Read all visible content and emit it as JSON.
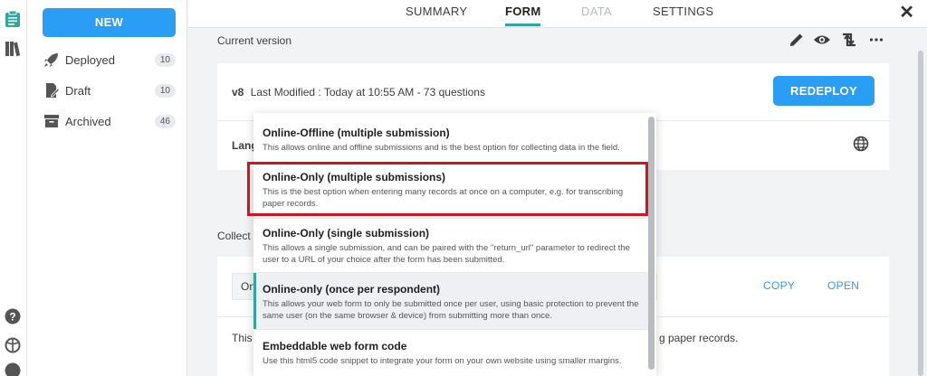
{
  "sidebar": {
    "new_label": "NEW",
    "items": [
      {
        "label": "Deployed",
        "count": "10",
        "icon": "rocket-icon"
      },
      {
        "label": "Draft",
        "count": "10",
        "icon": "draft-document-icon"
      },
      {
        "label": "Archived",
        "count": "46",
        "icon": "archive-box-icon"
      }
    ]
  },
  "tabs": [
    {
      "label": "SUMMARY",
      "state": "normal"
    },
    {
      "label": "FORM",
      "state": "active"
    },
    {
      "label": "DATA",
      "state": "disabled"
    },
    {
      "label": "SETTINGS",
      "state": "normal"
    }
  ],
  "close_label": "✕",
  "main": {
    "current_version_label": "Current version",
    "version": "v8",
    "last_modified": "Last Modified : Today at 10:55 AM - 73 questions",
    "redeploy_label": "REDEPLOY",
    "languages_label_visible": "Lang",
    "collect_label_visible": "Collect d",
    "select_value_visible": "On",
    "copy_label": "COPY",
    "open_label": "OPEN",
    "desc_left_visible": "This",
    "desc_right_visible": "g paper records."
  },
  "dropdown": {
    "options": [
      {
        "title": "Online-Offline (multiple submission)",
        "desc": "This allows online and offline submissions and is the best option for collecting data in the field."
      },
      {
        "title": "Online-Only (multiple submissions)",
        "desc": "This is the best option when entering many records at once on a computer, e.g. for transcribing paper records."
      },
      {
        "title": "Online-Only (single submission)",
        "desc": "This allows a single submission, and can be paired with the \"return_url\" parameter to redirect the user to a URL of your choice after the form has been submitted."
      },
      {
        "title": "Online-only (once per respondent)",
        "desc": "This allows your web form to only be submitted once per user, using basic protection to prevent the same user (on the same browser & device) from submitting more than once."
      },
      {
        "title": "Embeddable web form code",
        "desc": "Use this html5 code snippet to integrate your form on your own website using smaller margins."
      }
    ]
  },
  "colors": {
    "accent_blue": "#2a9df4",
    "accent_teal": "#2ea7a0",
    "highlight_red": "#d6121d"
  }
}
